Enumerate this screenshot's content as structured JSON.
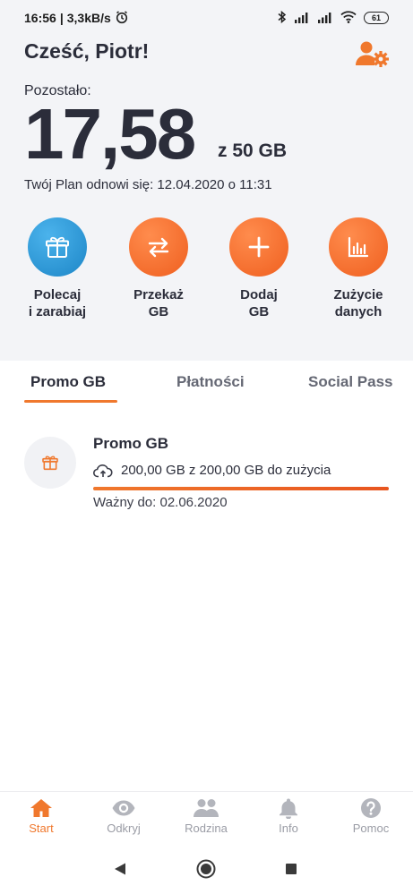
{
  "status_bar": {
    "time": "16:56",
    "speed": "3,3kB/s",
    "battery": "61"
  },
  "header": {
    "greeting": "Cześć, Piotr!",
    "profile_icon": "user-settings-icon"
  },
  "balance": {
    "label": "Pozostało:",
    "value": "17,58",
    "total": "z 50 GB",
    "renewal": "Twój Plan odnowi się: 12.04.2020 o 11:31"
  },
  "actions": [
    {
      "line1": "Polecaj",
      "line2": "i zarabiaj",
      "icon": "gift-icon",
      "color": "#2a97d8"
    },
    {
      "line1": "Przekaż",
      "line2": "GB",
      "icon": "transfer-arrows-icon",
      "color": "#f26b2b"
    },
    {
      "line1": "Dodaj",
      "line2": "GB",
      "icon": "plus-icon",
      "color": "#f26b2b"
    },
    {
      "line1": "Zużycie",
      "line2": "danych",
      "icon": "bar-chart-icon",
      "color": "#f26b2b"
    }
  ],
  "tabs": [
    "Promo GB",
    "Płatności",
    "Social Pass"
  ],
  "promo": {
    "title": "Promo GB",
    "usage": "200,00 GB z 200,00 GB do zużycia",
    "progress": 1.0,
    "valid": "Ważny do: 02.06.2020"
  },
  "nav": [
    {
      "label": "Start",
      "icon": "home-icon",
      "active": true
    },
    {
      "label": "Odkryj",
      "icon": "eye-icon",
      "active": false
    },
    {
      "label": "Rodzina",
      "icon": "family-icon",
      "active": false
    },
    {
      "label": "Info",
      "icon": "bell-icon",
      "active": false
    },
    {
      "label": "Pomoc",
      "icon": "help-icon",
      "active": false
    }
  ],
  "colors": {
    "accent": "#f0782d",
    "blue": "#2a97d8",
    "text": "#2b2d3a"
  }
}
